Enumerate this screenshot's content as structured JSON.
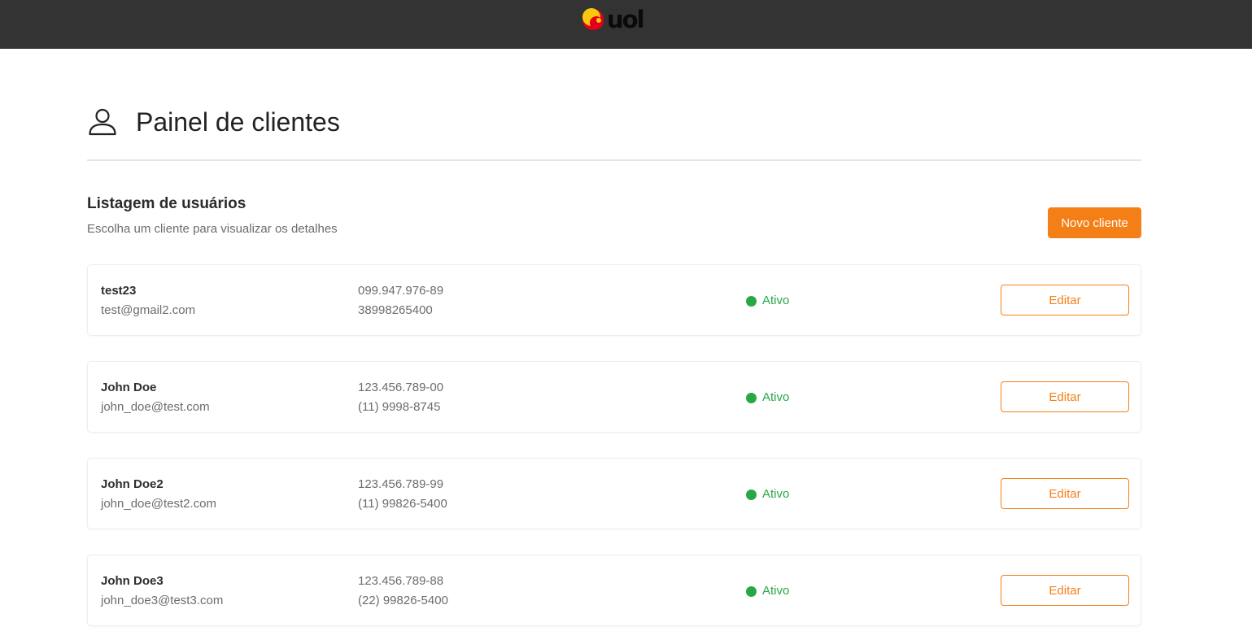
{
  "header": {
    "logo_text": "uol"
  },
  "page": {
    "title": "Painel de clientes",
    "icon": "person-icon"
  },
  "section": {
    "title": "Listagem de usuários",
    "subtitle": "Escolha um cliente para visualizar os detalhes",
    "new_button_label": "Novo cliente"
  },
  "clients": [
    {
      "name": "test23",
      "email": "test@gmail2.com",
      "document": "099.947.976-89",
      "phone": "38998265400",
      "status": "Ativo",
      "edit_label": "Editar"
    },
    {
      "name": "John Doe",
      "email": "john_doe@test.com",
      "document": "123.456.789-00",
      "phone": "(11) 9998-8745",
      "status": "Ativo",
      "edit_label": "Editar"
    },
    {
      "name": "John Doe2",
      "email": "john_doe@test2.com",
      "document": "123.456.789-99",
      "phone": "(11) 99826-5400",
      "status": "Ativo",
      "edit_label": "Editar"
    },
    {
      "name": "John Doe3",
      "email": "john_doe3@test3.com",
      "document": "123.456.789-88",
      "phone": "(22) 99826-5400",
      "status": "Ativo",
      "edit_label": "Editar"
    }
  ],
  "colors": {
    "topbar": "#333333",
    "accent": "#f57f17",
    "status_active": "#28a745",
    "logo_yellow": "#f9c80e",
    "logo_red": "#e3001b"
  }
}
